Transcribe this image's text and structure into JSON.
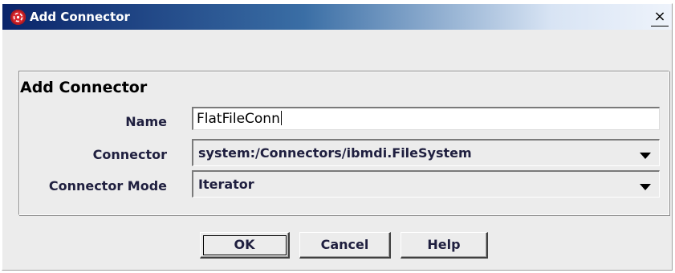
{
  "window": {
    "title": "Add Connector",
    "close_glyph": "×",
    "icon": "connector-app-icon"
  },
  "group": {
    "title": "Add Connector"
  },
  "form": {
    "name_label": "Name",
    "name_value": "FlatFileConn",
    "connector_label": "Connector",
    "connector_value": "system:/Connectors/ibmdi.FileSystem",
    "mode_label": "Connector Mode",
    "mode_value": "Iterator"
  },
  "buttons": {
    "ok": "OK",
    "cancel": "Cancel",
    "help": "Help"
  },
  "colors": {
    "titlebar_start": "#0a246a",
    "titlebar_end": "#eef3fb",
    "dialog_bg": "#ececec",
    "icon_red": "#d8272d"
  }
}
